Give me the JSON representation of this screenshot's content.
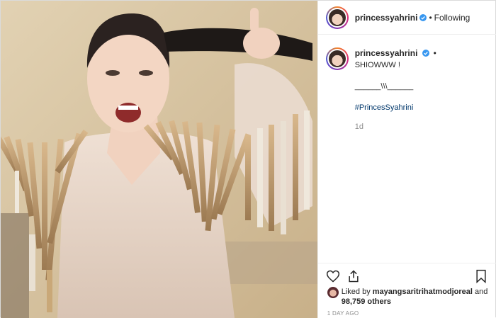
{
  "header": {
    "username": "princessyahrini",
    "separator": "•",
    "follow_state": "Following"
  },
  "caption": {
    "username": "princessyahrini",
    "separator": "•",
    "line1": "SHIOWWW !",
    "line2": "______\\\\\\______",
    "hashtag": "#PrincesSyahrini",
    "time": "1d"
  },
  "icons": {
    "like": "heart-icon",
    "share": "share-icon",
    "save": "bookmark-icon",
    "verified": "verified-badge-icon"
  },
  "likes": {
    "prefix": "Liked by",
    "user": "mayangsaritrihatmodjoreal",
    "conj": "and",
    "count": "98,759 others"
  },
  "timestamp": "1 DAY AGO",
  "colors": {
    "verified": "#3897f0",
    "link": "#00376b",
    "muted": "#8e8e8e"
  }
}
